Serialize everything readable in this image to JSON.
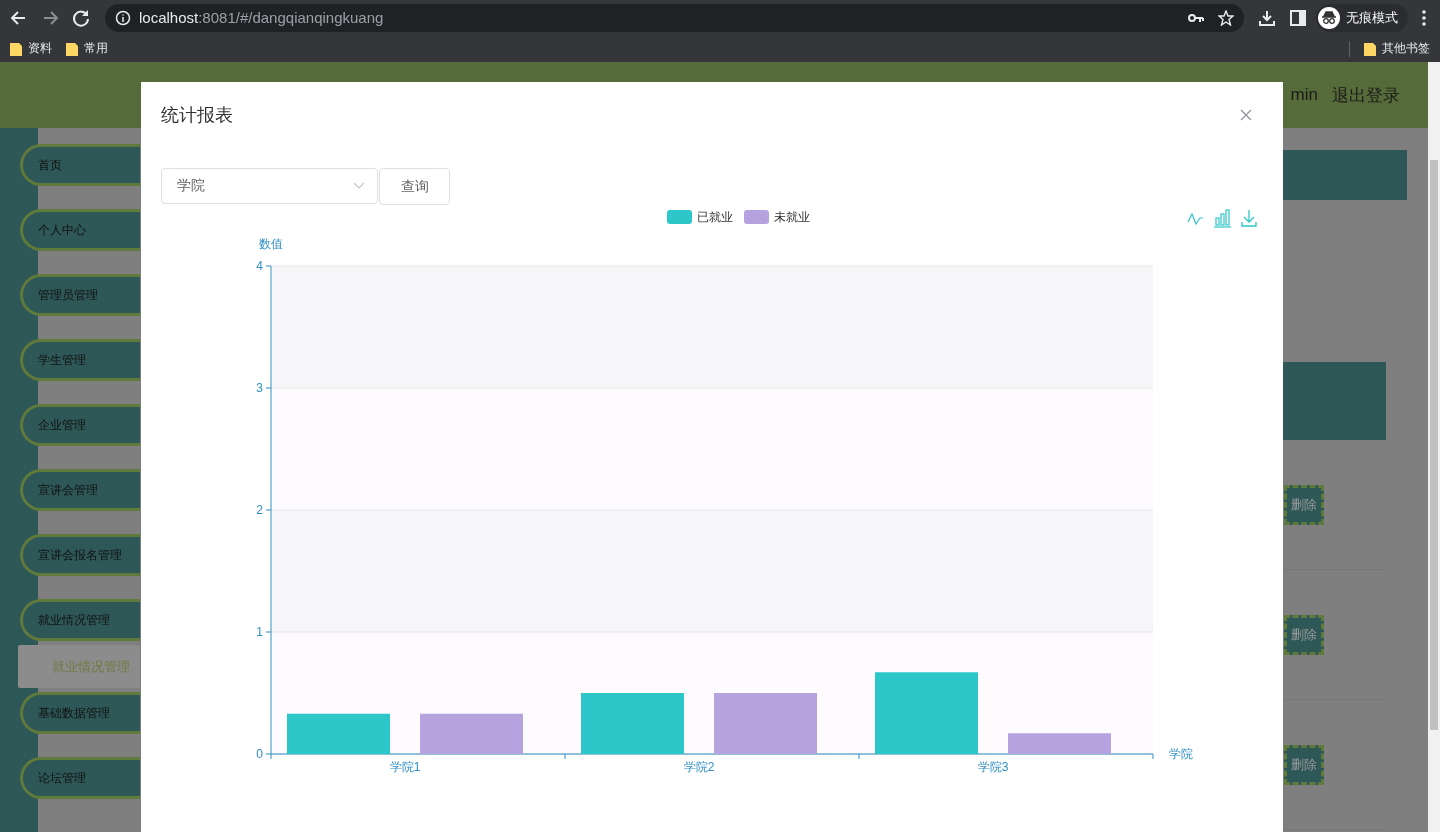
{
  "browser": {
    "url_host": "localhost",
    "url_path": ":8081/#/dangqianqingkuang",
    "profile_label": "无痕模式",
    "bookmarks": [
      "资料",
      "常用"
    ],
    "other_bookmarks": "其他书签"
  },
  "header": {
    "user": "min",
    "logout": "退出登录"
  },
  "sidebar": {
    "items": [
      {
        "label": "首页",
        "selected": false
      },
      {
        "label": "个人中心",
        "selected": false
      },
      {
        "label": "管理员管理",
        "selected": false
      },
      {
        "label": "学生管理",
        "selected": false
      },
      {
        "label": "企业管理",
        "selected": false
      },
      {
        "label": "宣讲会管理",
        "selected": false
      },
      {
        "label": "宣讲会报名管理",
        "selected": false
      },
      {
        "label": "就业情况管理",
        "selected": false,
        "children": [
          {
            "label": "就业情况管理",
            "selected": true
          }
        ]
      },
      {
        "label": "基础数据管理",
        "selected": false
      },
      {
        "label": "论坛管理",
        "selected": false
      }
    ]
  },
  "table_rows": [
    {
      "action": "删除"
    },
    {
      "action": "删除"
    },
    {
      "action": "删除"
    }
  ],
  "dialog": {
    "title": "统计报表",
    "select": {
      "value": "学院"
    },
    "query_button": "查询",
    "chart_data": {
      "type": "bar",
      "xlabel": "学院",
      "ylabel": "数值",
      "categories": [
        "学院1",
        "学院2",
        "学院3"
      ],
      "series": [
        {
          "name": "已就业",
          "color": "#2ec7c9",
          "values": [
            0.33,
            0.5,
            0.67
          ]
        },
        {
          "name": "未就业",
          "color": "#b6a2de",
          "values": [
            0.33,
            0.5,
            0.17
          ]
        }
      ],
      "ylim": [
        0,
        4
      ],
      "yticks": [
        0,
        1,
        2,
        3,
        4
      ],
      "grid": true,
      "legend": true
    }
  }
}
